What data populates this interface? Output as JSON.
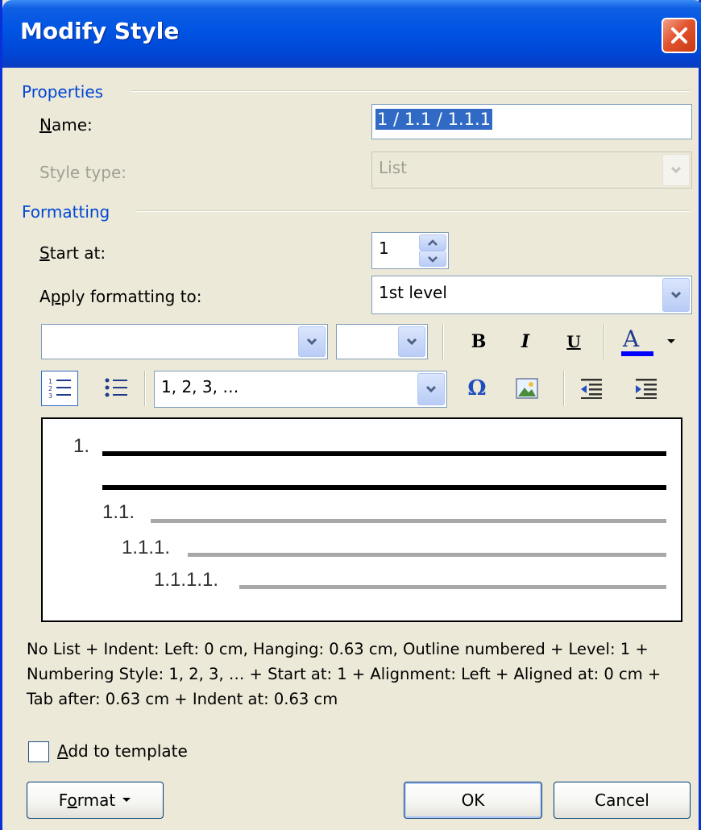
{
  "window": {
    "title": "Modify Style"
  },
  "properties": {
    "group_label": "Properties",
    "name_label": "Name:",
    "name_label_mnemonic": "N",
    "name_label_rest": "ame:",
    "name_value": "1 / 1.1 / 1.1.1",
    "style_type_label": "Style type:",
    "style_type_value": "List"
  },
  "formatting": {
    "group_label": "Formatting",
    "start_at_label_mnemonic": "S",
    "start_at_label_rest": "tart at:",
    "start_at_value": "1",
    "apply_label_pre": "A",
    "apply_label_mnemonic": "p",
    "apply_label_rest": "ply formatting to:",
    "apply_value": "1st level",
    "font_name_value": "",
    "font_size_value": "",
    "bold_label": "B",
    "italic_label": "I",
    "underline_label": "U",
    "font_color_label": "A",
    "font_color": "#0000ff",
    "numbering_style_value": "1, 2, 3, …",
    "symbol_label": "Ω"
  },
  "preview": {
    "levels": [
      "1.",
      "1.1.",
      "1.1.1.",
      "1.1.1.1."
    ]
  },
  "description": "No List + Indent: Left:  0 cm, Hanging:  0.63 cm, Outline numbered + Level: 1 + Numbering Style: 1, 2, 3, … + Start at: 1 + Alignment: Left + Aligned at:  0 cm + Tab after:  0.63 cm + Indent at:  0.63 cm",
  "footer": {
    "add_to_template_mnemonic": "A",
    "add_to_template_rest": "dd to template",
    "add_to_template_checked": false,
    "format_pre": "F",
    "format_mnemonic": "o",
    "format_rest": "rmat",
    "ok_label": "OK",
    "cancel_label": "Cancel"
  }
}
